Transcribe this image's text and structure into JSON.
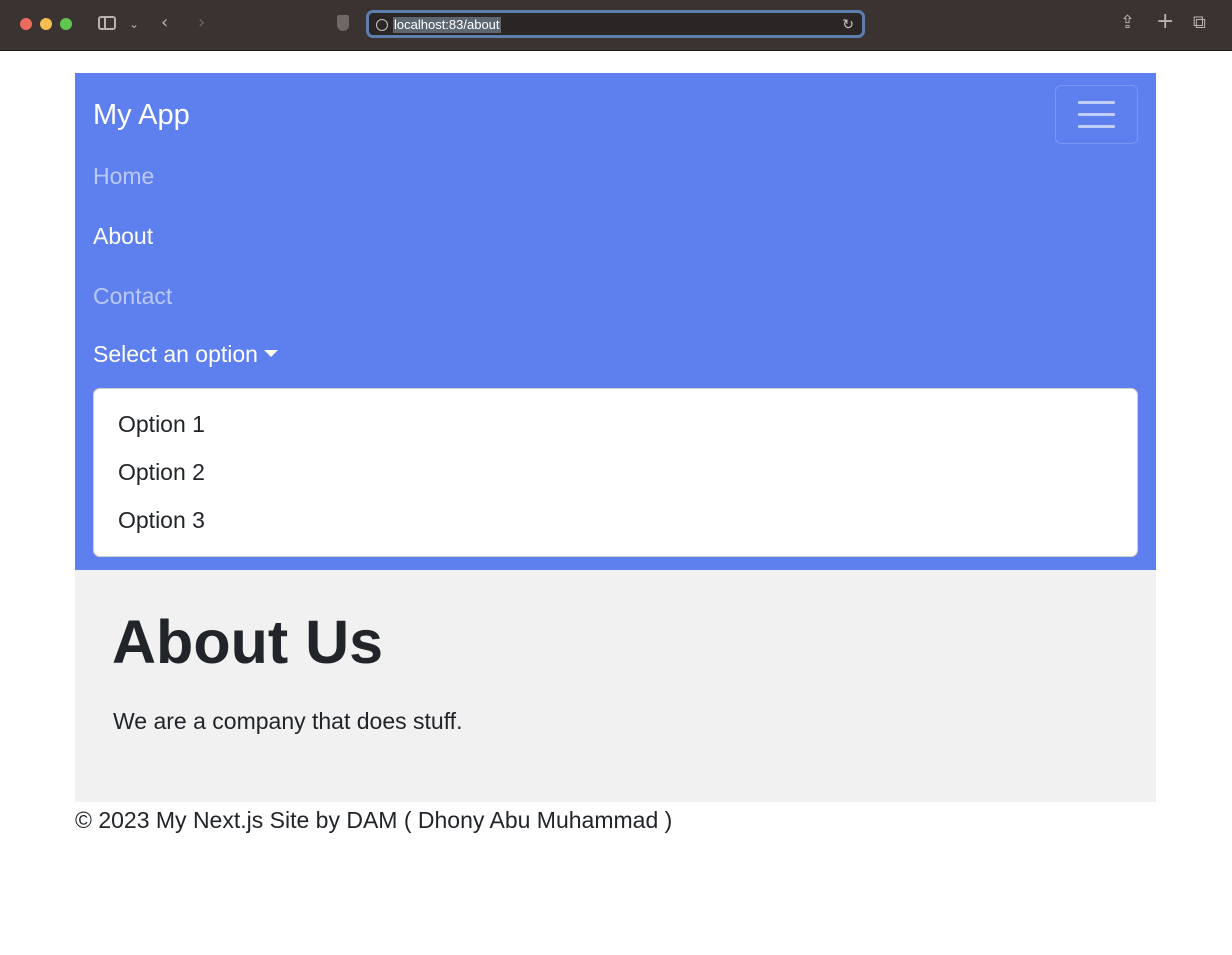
{
  "browser": {
    "url": "localhost:83/about",
    "back_icon": "chevron-left-icon",
    "forward_icon": "chevron-right-icon"
  },
  "navbar": {
    "brand": "My App",
    "toggler_icon": "hamburger-menu-icon",
    "links": [
      {
        "label": "Home",
        "state": "inactive"
      },
      {
        "label": "About",
        "state": "active"
      },
      {
        "label": "Contact",
        "state": "inactive"
      }
    ],
    "dropdown": {
      "label": "Select an option",
      "options": [
        "Option 1",
        "Option 2",
        "Option 3"
      ],
      "expanded": true
    },
    "colors": {
      "background": "#5e7fee"
    }
  },
  "main": {
    "title": "About Us",
    "description": "We are a company that does stuff."
  },
  "footer": {
    "text": "© 2023 My Next.js Site by DAM ( Dhony Abu Muhammad )"
  }
}
